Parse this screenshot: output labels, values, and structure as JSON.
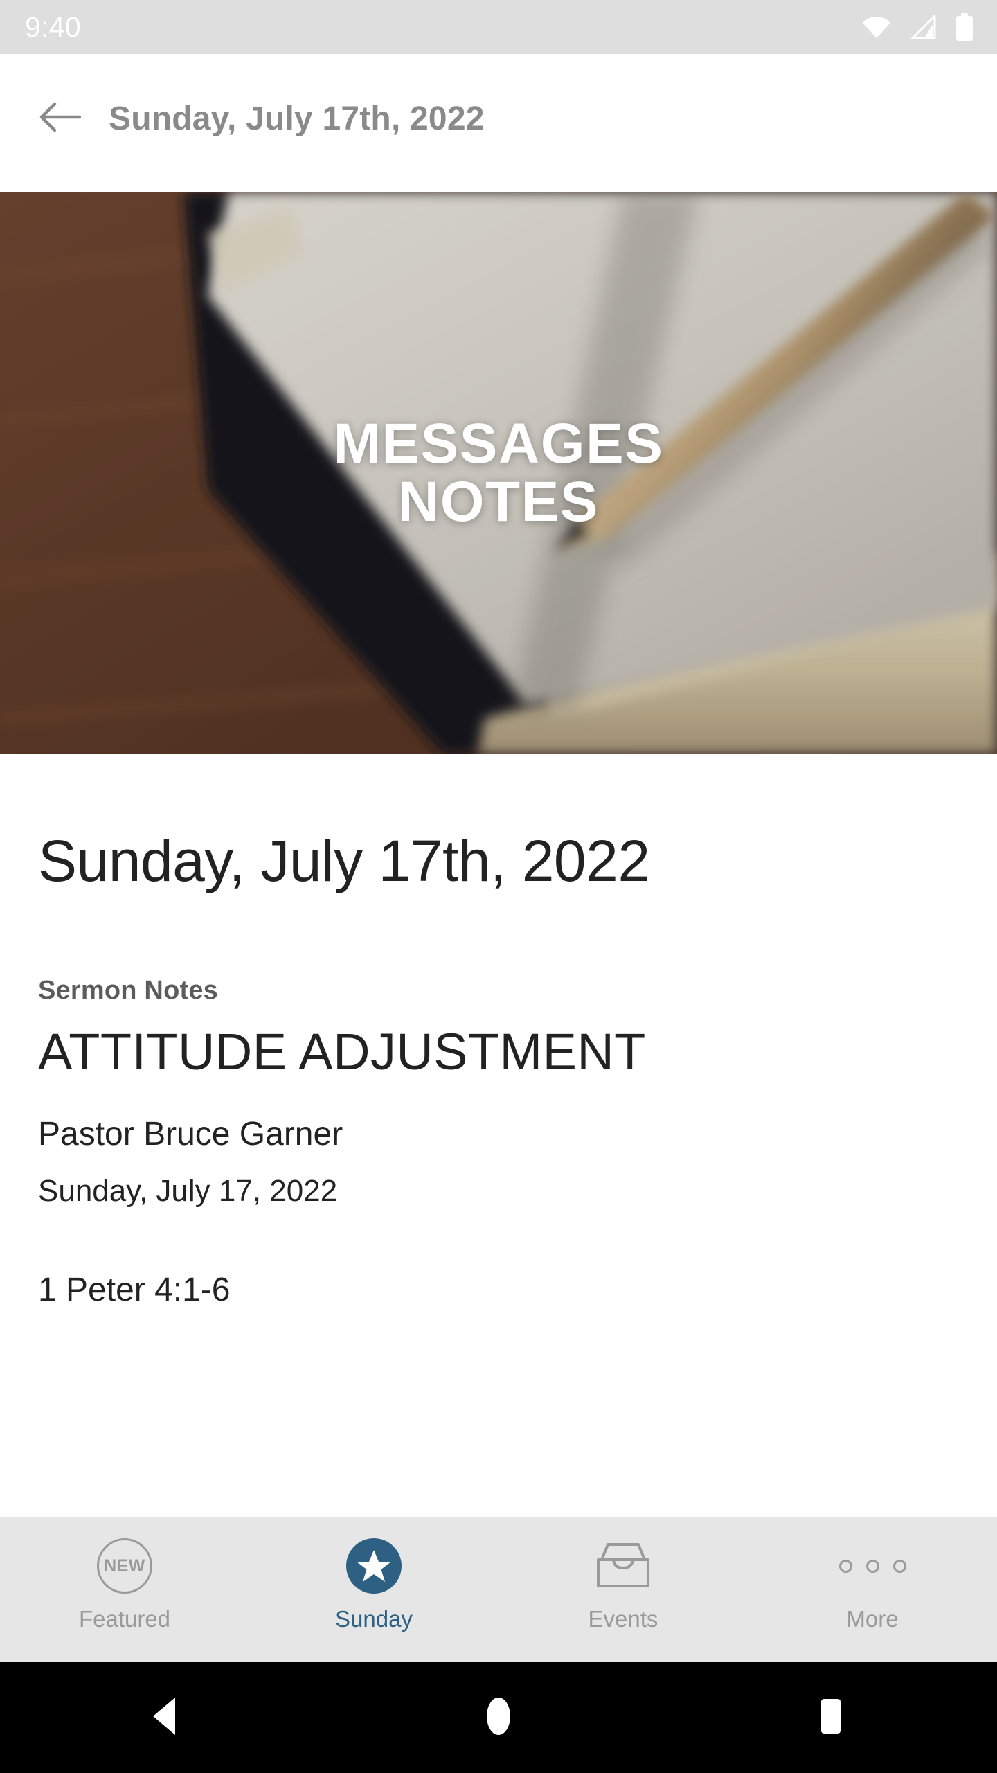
{
  "status_bar": {
    "time": "9:40",
    "icons": [
      "wifi-icon",
      "cellular-signal-icon",
      "battery-icon"
    ]
  },
  "header": {
    "back_icon": "arrow-left-icon",
    "title": "Sunday, July 17th, 2022"
  },
  "hero": {
    "title_line_1": "MESSAGES",
    "title_line_2": "NOTES",
    "image_description": "open-notebook-with-pencil-on-wooden-desk",
    "wood_color": "#5d3a28",
    "page_color": "#dcd8d0"
  },
  "content": {
    "title": "Sunday, July 17th, 2022",
    "kicker": "Sermon Notes",
    "heading": "ATTITUDE ADJUSTMENT",
    "speaker": "Pastor Bruce Garner",
    "date": "Sunday, July 17, 2022",
    "scripture": "1 Peter 4:1-6"
  },
  "tabbar": {
    "accent_color": "#2d6083",
    "inactive_color": "#9a9a9a",
    "items": [
      {
        "label": "Featured",
        "icon": "new-badge-icon",
        "badge_text": "NEW",
        "active": false
      },
      {
        "label": "Sunday",
        "icon": "star-icon",
        "active": true
      },
      {
        "label": "Events",
        "icon": "inbox-tray-icon",
        "active": false
      },
      {
        "label": "More",
        "icon": "three-dots-icon",
        "active": false
      }
    ]
  },
  "navbar": {
    "back": "android-back-icon",
    "home": "android-home-icon",
    "recents": "android-recents-icon"
  }
}
